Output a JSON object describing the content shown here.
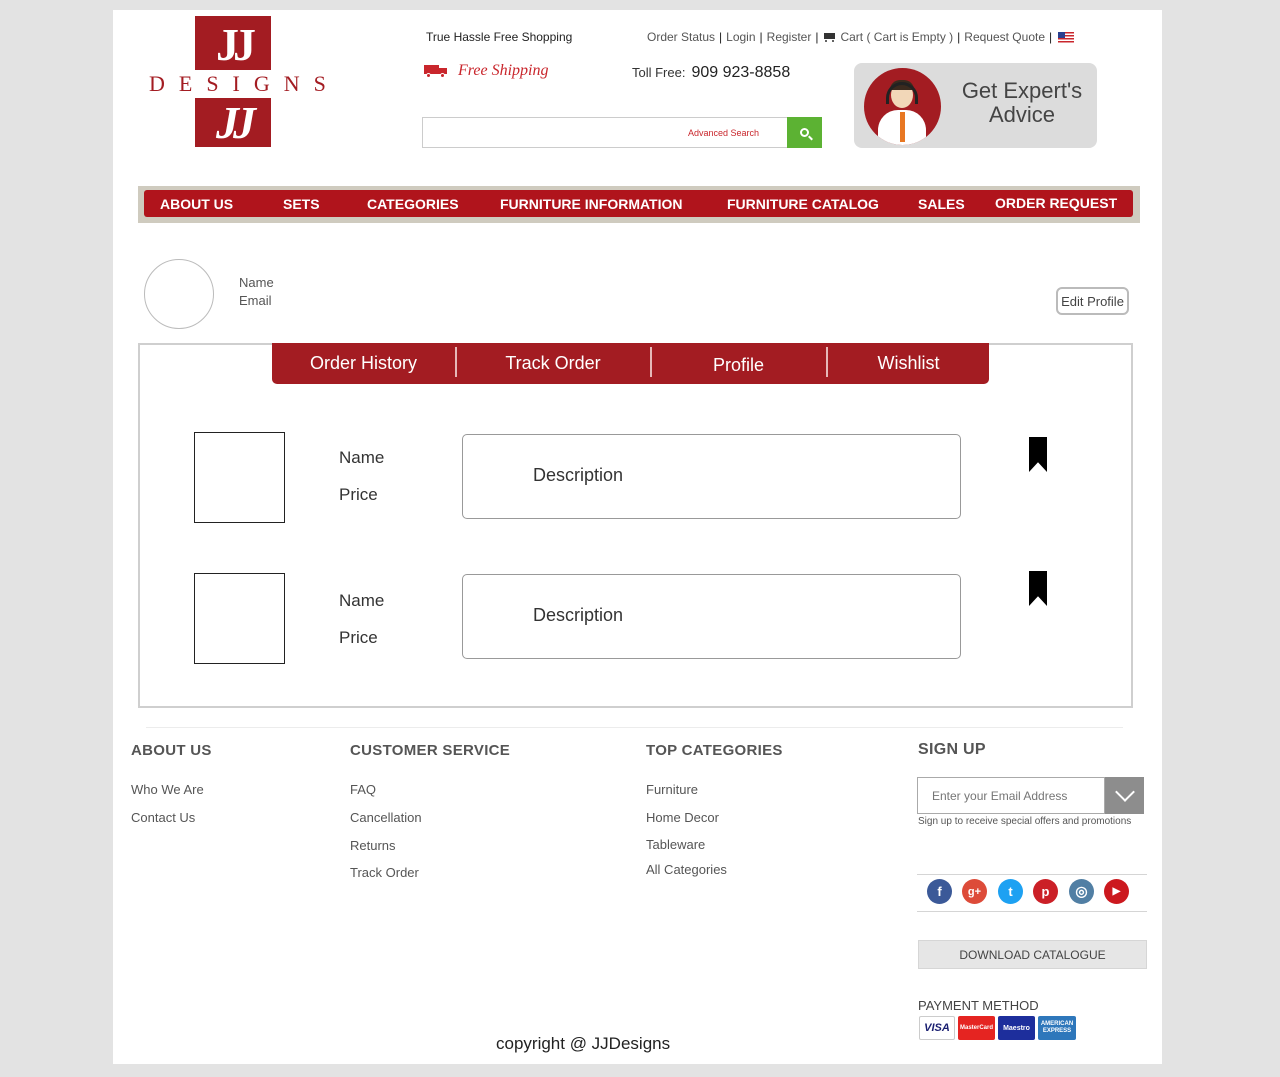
{
  "logo": {
    "mark_top": "JJ",
    "mark_bottom": "JJ",
    "wordmark": "DESIGNS"
  },
  "header": {
    "tagline": "True Hassle Free Shopping",
    "free_shipping": "Free Shipping",
    "toll_free_label": "Toll Free:",
    "toll_free_number": "909 923-8858",
    "links": {
      "order_status": "Order Status",
      "login": "Login",
      "register": "Register",
      "cart": "Cart ( Cart is Empty )",
      "request_quote": "Request Quote"
    },
    "search": {
      "placeholder": "",
      "advanced": "Advanced Search"
    },
    "expert": {
      "line1": "Get Expert's",
      "line2": "Advice"
    }
  },
  "nav": [
    "ABOUT US",
    "SETS",
    "CATEGORIES",
    "FURNITURE INFORMATION",
    "FURNITURE CATALOG",
    "SALES",
    "ORDER REQUEST"
  ],
  "profile": {
    "name_label": "Name",
    "email_label": "Email",
    "edit_button": "Edit Profile"
  },
  "tabs": [
    "Order History",
    "Track Order",
    "Profile",
    "Wishlist"
  ],
  "items": [
    {
      "name": "Name",
      "price": "Price",
      "description": "Description"
    },
    {
      "name": "Name",
      "price": "Price",
      "description": "Description"
    }
  ],
  "footer": {
    "about": {
      "heading": "ABOUT US",
      "links": [
        "Who We Are",
        "Contact Us"
      ]
    },
    "service": {
      "heading": "CUSTOMER SERVICE",
      "links": [
        "FAQ",
        "Cancellation",
        "Returns",
        "Track Order"
      ]
    },
    "categories": {
      "heading": "TOP CATEGORIES",
      "links": [
        "Furniture",
        "Home Decor",
        "Tableware",
        "All Categories"
      ]
    },
    "signup": {
      "heading": "SIGN UP",
      "placeholder": "Enter your Email Address",
      "note": "Sign up to receive special offers and promotions"
    },
    "social": [
      {
        "icon": "facebook-icon",
        "glyph": "f",
        "color": "#3b5998"
      },
      {
        "icon": "google-plus-icon",
        "glyph": "g+",
        "color": "#dd4b39"
      },
      {
        "icon": "twitter-icon",
        "glyph": "t",
        "color": "#1da1f2"
      },
      {
        "icon": "pinterest-icon",
        "glyph": "p",
        "color": "#cb2027"
      },
      {
        "icon": "instagram-icon",
        "glyph": "◎",
        "color": "#517fa4"
      },
      {
        "icon": "youtube-icon",
        "glyph": "▶",
        "color": "#cc181e"
      }
    ],
    "download": "DOWNLOAD CATALOGUE",
    "payment_label": "PAYMENT METHOD",
    "cards": [
      "VISA",
      "MasterCard",
      "Maestro",
      "AMERICAN EXPRESS"
    ],
    "copyright": "copyright @ JJDesigns"
  },
  "colors": {
    "brand_red": "#a31c22",
    "nav_red": "#b0141c",
    "search_green": "#5cb233"
  }
}
